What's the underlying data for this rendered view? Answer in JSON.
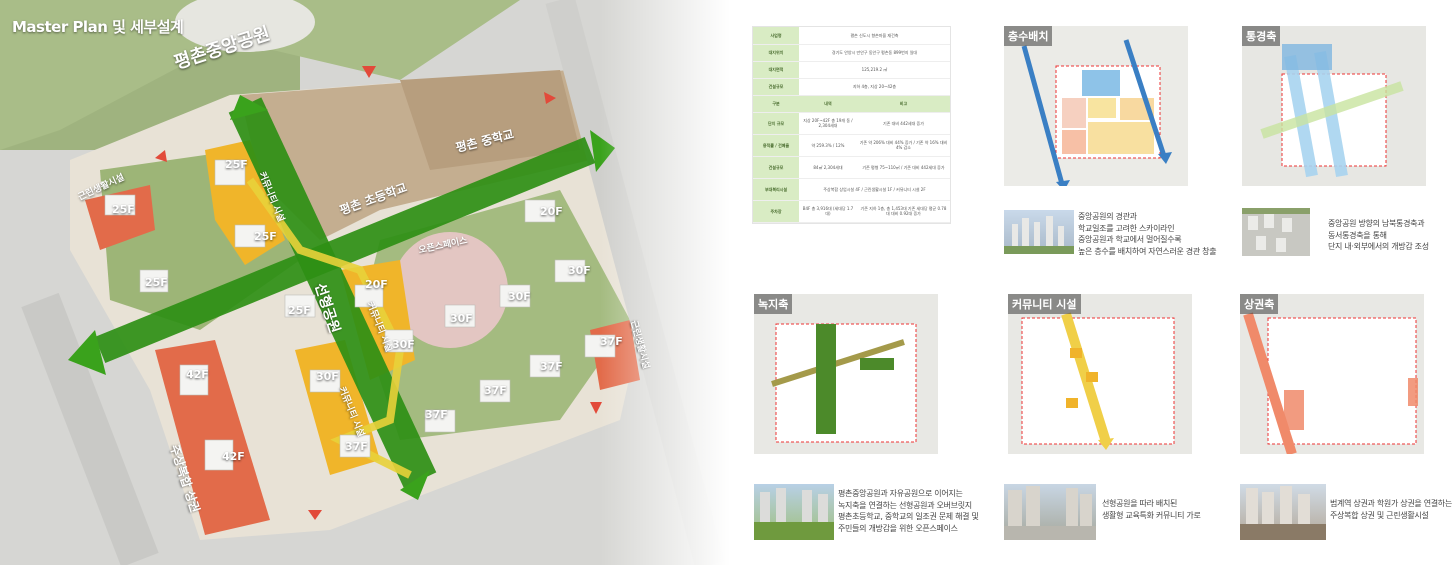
{
  "masterplan": {
    "title": "Master Plan 및 세부설계",
    "labels": {
      "central_park": "평촌중앙공원",
      "middle_school": "평촌 중학교",
      "elementary_school": "평촌 초등학교",
      "open_space": "오픈스페이스",
      "linear_park": "선형공원",
      "community_1": "커뮤니티 시설",
      "community_2": "커뮤니티 시설",
      "community_3": "커뮤니티 시설",
      "neighborhood": "근린생활시설",
      "neighborhood_2": "근린생활시설",
      "mixed_commercial": "주상복합 상권"
    },
    "floors": [
      "25F",
      "25F",
      "25F",
      "25F",
      "25F",
      "25F",
      "20F",
      "20F",
      "30F",
      "30F",
      "30F",
      "30F",
      "30F",
      "37F",
      "37F",
      "37F",
      "37F",
      "37F",
      "37F",
      "42F",
      "42F",
      "20F"
    ]
  },
  "summary": {
    "rows": [
      {
        "label": "사업명",
        "value": "평촌 신도시 향촌마을 재건축"
      },
      {
        "label": "대지위치",
        "value": "경기도 안양시 만안구 동안구 평촌동 899번지 일대"
      },
      {
        "label": "대지면적",
        "value": "125,219.2 ㎡"
      },
      {
        "label": "건설규모",
        "value": "지하 4층, 지상 20~42층"
      }
    ],
    "header": {
      "label": "구분",
      "col1": "내역",
      "col2": "비고"
    },
    "detail_rows": [
      {
        "label": "단지 규모",
        "col1": "지상 20F~42F 총 19개 동 / 2,304세대",
        "col2": "기존 대비 442세대 증가"
      },
      {
        "label": "용적률 / 건폐율",
        "col1": "약 259.3% / 12%",
        "col2": "기존 약 206% 대비 44% 증가 / 기존 약 16% 대비 4% 감소"
      },
      {
        "label": "건설규모",
        "col1": "84㎡ 2,304세대",
        "col2": "기존 평형 75~110㎡ / 기존 대비 442세대 증가"
      },
      {
        "label": "부대복리시설",
        "col1": "주상복합 상업시설 4F / 근린생활시설 1F / 커뮤니티 시설 2F",
        "col2": ""
      },
      {
        "label": "주차장",
        "col1": "B4F 총 3,916대 (세대당 1.7대)",
        "col2": "기존 지하 1층, 총 1,453대 기존 세대당 평균 0.78대 대비 0.92대 증가"
      }
    ]
  },
  "panels": [
    {
      "title": "층수배치",
      "caption": [
        "중앙공원의 경관과",
        "학교일조를 고려한 스카이라인",
        "중앙공원과 학교에서 멀어질수록",
        "높은 층수를 배치하여 자연스러운 경관 창출"
      ]
    },
    {
      "title": "통경축",
      "caption": [
        "중앙공원 방향의 남북통경축과",
        "동서통경축을 통해",
        "단지 내·외부에서의 개방감 조성"
      ]
    },
    {
      "title": "녹지축",
      "caption": [
        "평촌중앙공원과 자유공원으로 이어지는",
        "녹지축을 연결하는 선형공원과 오버브릿지",
        "평촌초등학교, 중학교의 일조권 문제 해결 및",
        "주민들의 개방감을 위한 오픈스페이스"
      ]
    },
    {
      "title": "커뮤니티 시설",
      "caption": [
        "선형공원을 따라 배치된",
        "생활형 교육특화 커뮤니티 가로"
      ]
    },
    {
      "title": "상권축",
      "caption": [
        "범계역 상권과 학원가 상권을 연결하는",
        "주상복합 상권 및 근린생활시설"
      ]
    }
  ],
  "colors": {
    "green": "#3a9b1c",
    "yellow": "#f0c020",
    "orange": "#e26b4a",
    "blue": "#4a8fd4"
  }
}
